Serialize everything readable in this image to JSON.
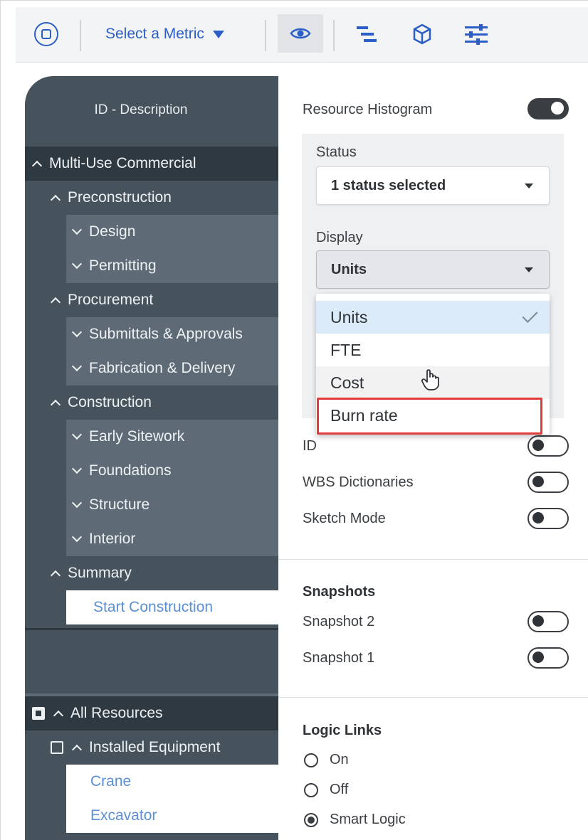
{
  "toolbar": {
    "metric_label": "Select a Metric",
    "icons": [
      "app-logo-icon",
      "eye-icon",
      "gantt-bars-icon",
      "cube-icon",
      "sliders-icon"
    ]
  },
  "grid": {
    "column_header": "ID - Description",
    "rows": [
      {
        "label": "Multi-Use Commercial",
        "level": 0,
        "state": "expanded"
      },
      {
        "label": "Preconstruction",
        "level": 1,
        "state": "expanded"
      },
      {
        "label": "Design",
        "level": 2,
        "state": "collapsed"
      },
      {
        "label": "Permitting",
        "level": 2,
        "state": "collapsed"
      },
      {
        "label": "Procurement",
        "level": 1,
        "state": "expanded"
      },
      {
        "label": "Submittals & Approvals",
        "level": 2,
        "state": "collapsed"
      },
      {
        "label": "Fabrication & Delivery",
        "level": 2,
        "state": "collapsed"
      },
      {
        "label": "Construction",
        "level": 1,
        "state": "expanded"
      },
      {
        "label": "Early Sitework",
        "level": 2,
        "state": "collapsed"
      },
      {
        "label": "Foundations",
        "level": 2,
        "state": "collapsed"
      },
      {
        "label": "Structure",
        "level": 2,
        "state": "collapsed"
      },
      {
        "label": "Interior",
        "level": 2,
        "state": "collapsed"
      },
      {
        "label": "Summary",
        "level": 1,
        "state": "expanded"
      },
      {
        "label": "Start Construction",
        "level": 3,
        "state": "leaf"
      }
    ]
  },
  "resources": {
    "rows": [
      {
        "label": "All Resources",
        "level": 0
      },
      {
        "label": "Installed Equipment",
        "level": 1
      },
      {
        "label": "Crane",
        "level": 2
      },
      {
        "label": "Excavator",
        "level": 2
      }
    ]
  },
  "settings": {
    "histogram_label": "Resource Histogram",
    "histogram_on": true,
    "status_label": "Status",
    "status_value": "1 status selected",
    "display_label": "Display",
    "display_value": "Units",
    "display_options": [
      {
        "label": "Units",
        "selected": true
      },
      {
        "label": "FTE",
        "selected": false
      },
      {
        "label": "Cost",
        "selected": false
      },
      {
        "label": "Burn rate",
        "selected": false
      }
    ],
    "toggles": [
      {
        "label": "ID",
        "on": false
      },
      {
        "label": "WBS Dictionaries",
        "on": false
      },
      {
        "label": "Sketch Mode",
        "on": false
      }
    ],
    "snapshots_title": "Snapshots",
    "snapshots": [
      {
        "label": "Snapshot 2",
        "on": false
      },
      {
        "label": "Snapshot 1",
        "on": false
      }
    ],
    "logic_title": "Logic Links",
    "logic_options": [
      {
        "label": "On",
        "checked": false
      },
      {
        "label": "Off",
        "checked": false
      },
      {
        "label": "Smart Logic",
        "checked": true
      }
    ]
  },
  "colors": {
    "accent": "#2b5fc7",
    "tree_dark": "#2f3941",
    "tree_mid": "#46525c",
    "tree_light": "#5e6b76",
    "link": "#5b8fd6",
    "highlight_border": "#e23b3b",
    "selected_option": "#dcebf9"
  }
}
